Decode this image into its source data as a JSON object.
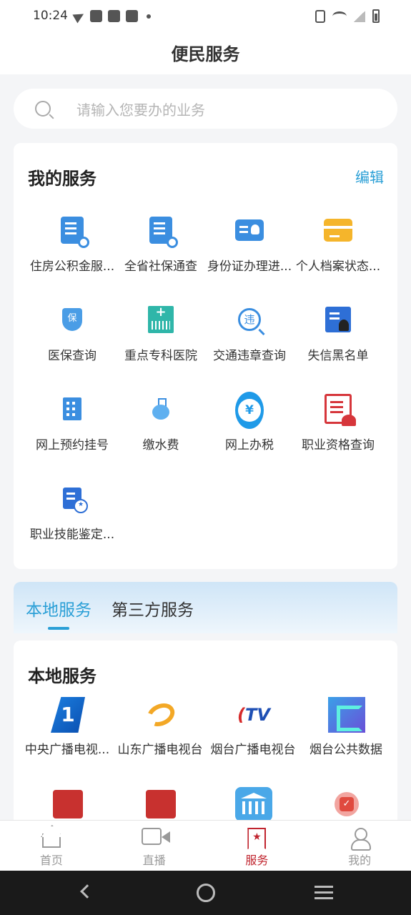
{
  "status_bar": {
    "time": "10:24"
  },
  "header": {
    "title": "便民服务"
  },
  "search": {
    "placeholder": "请输入您要办的业务"
  },
  "my_services": {
    "title": "我的服务",
    "edit_label": "编辑",
    "items": [
      {
        "label": "住房公积金服...",
        "icon": "housing-fund-doc-icon"
      },
      {
        "label": "全省社保通查",
        "icon": "social-security-doc-icon"
      },
      {
        "label": "身份证办理进...",
        "icon": "id-card-icon"
      },
      {
        "label": "个人档案状态...",
        "icon": "archive-card-icon"
      },
      {
        "label": "医保查询",
        "icon": "medical-insurance-shield-icon",
        "glyph": "保"
      },
      {
        "label": "重点专科医院",
        "icon": "hospital-icon"
      },
      {
        "label": "交通违章查询",
        "icon": "traffic-violation-icon",
        "glyph": "违"
      },
      {
        "label": "失信黑名单",
        "icon": "blacklist-icon"
      },
      {
        "label": "网上预约挂号",
        "icon": "building-icon"
      },
      {
        "label": "缴水费",
        "icon": "water-flask-icon"
      },
      {
        "label": "网上办税",
        "icon": "tax-yuan-icon",
        "glyph": "¥"
      },
      {
        "label": "职业资格查询",
        "icon": "certificate-icon"
      },
      {
        "label": "职业技能鉴定...",
        "icon": "skill-doc-icon"
      }
    ]
  },
  "tabs": [
    {
      "label": "本地服务",
      "active": true
    },
    {
      "label": "第三方服务",
      "active": false
    }
  ],
  "local_services": {
    "title": "本地服务",
    "items": [
      {
        "label": "中央广播电视...",
        "icon": "cctv-logo-icon"
      },
      {
        "label": "山东广播电视台",
        "icon": "shandong-tv-logo-icon"
      },
      {
        "label": "烟台广播电视台",
        "icon": "yantai-tv-logo-icon"
      },
      {
        "label": "烟台公共数据",
        "icon": "yantai-data-logo-icon"
      },
      {
        "label": "",
        "icon": "seal-icon"
      },
      {
        "label": "",
        "icon": "seal-icon"
      },
      {
        "label": "",
        "icon": "government-building-icon"
      },
      {
        "label": "",
        "icon": "check-badge-icon"
      }
    ]
  },
  "bottom_nav": {
    "items": [
      {
        "label": "首页",
        "icon": "home-icon"
      },
      {
        "label": "直播",
        "icon": "video-camera-icon"
      },
      {
        "label": "服务",
        "icon": "service-bookmark-icon",
        "active": true
      },
      {
        "label": "我的",
        "icon": "user-icon"
      }
    ]
  },
  "colors": {
    "accent": "#2a9fd6",
    "nav_active": "#c0242e"
  }
}
